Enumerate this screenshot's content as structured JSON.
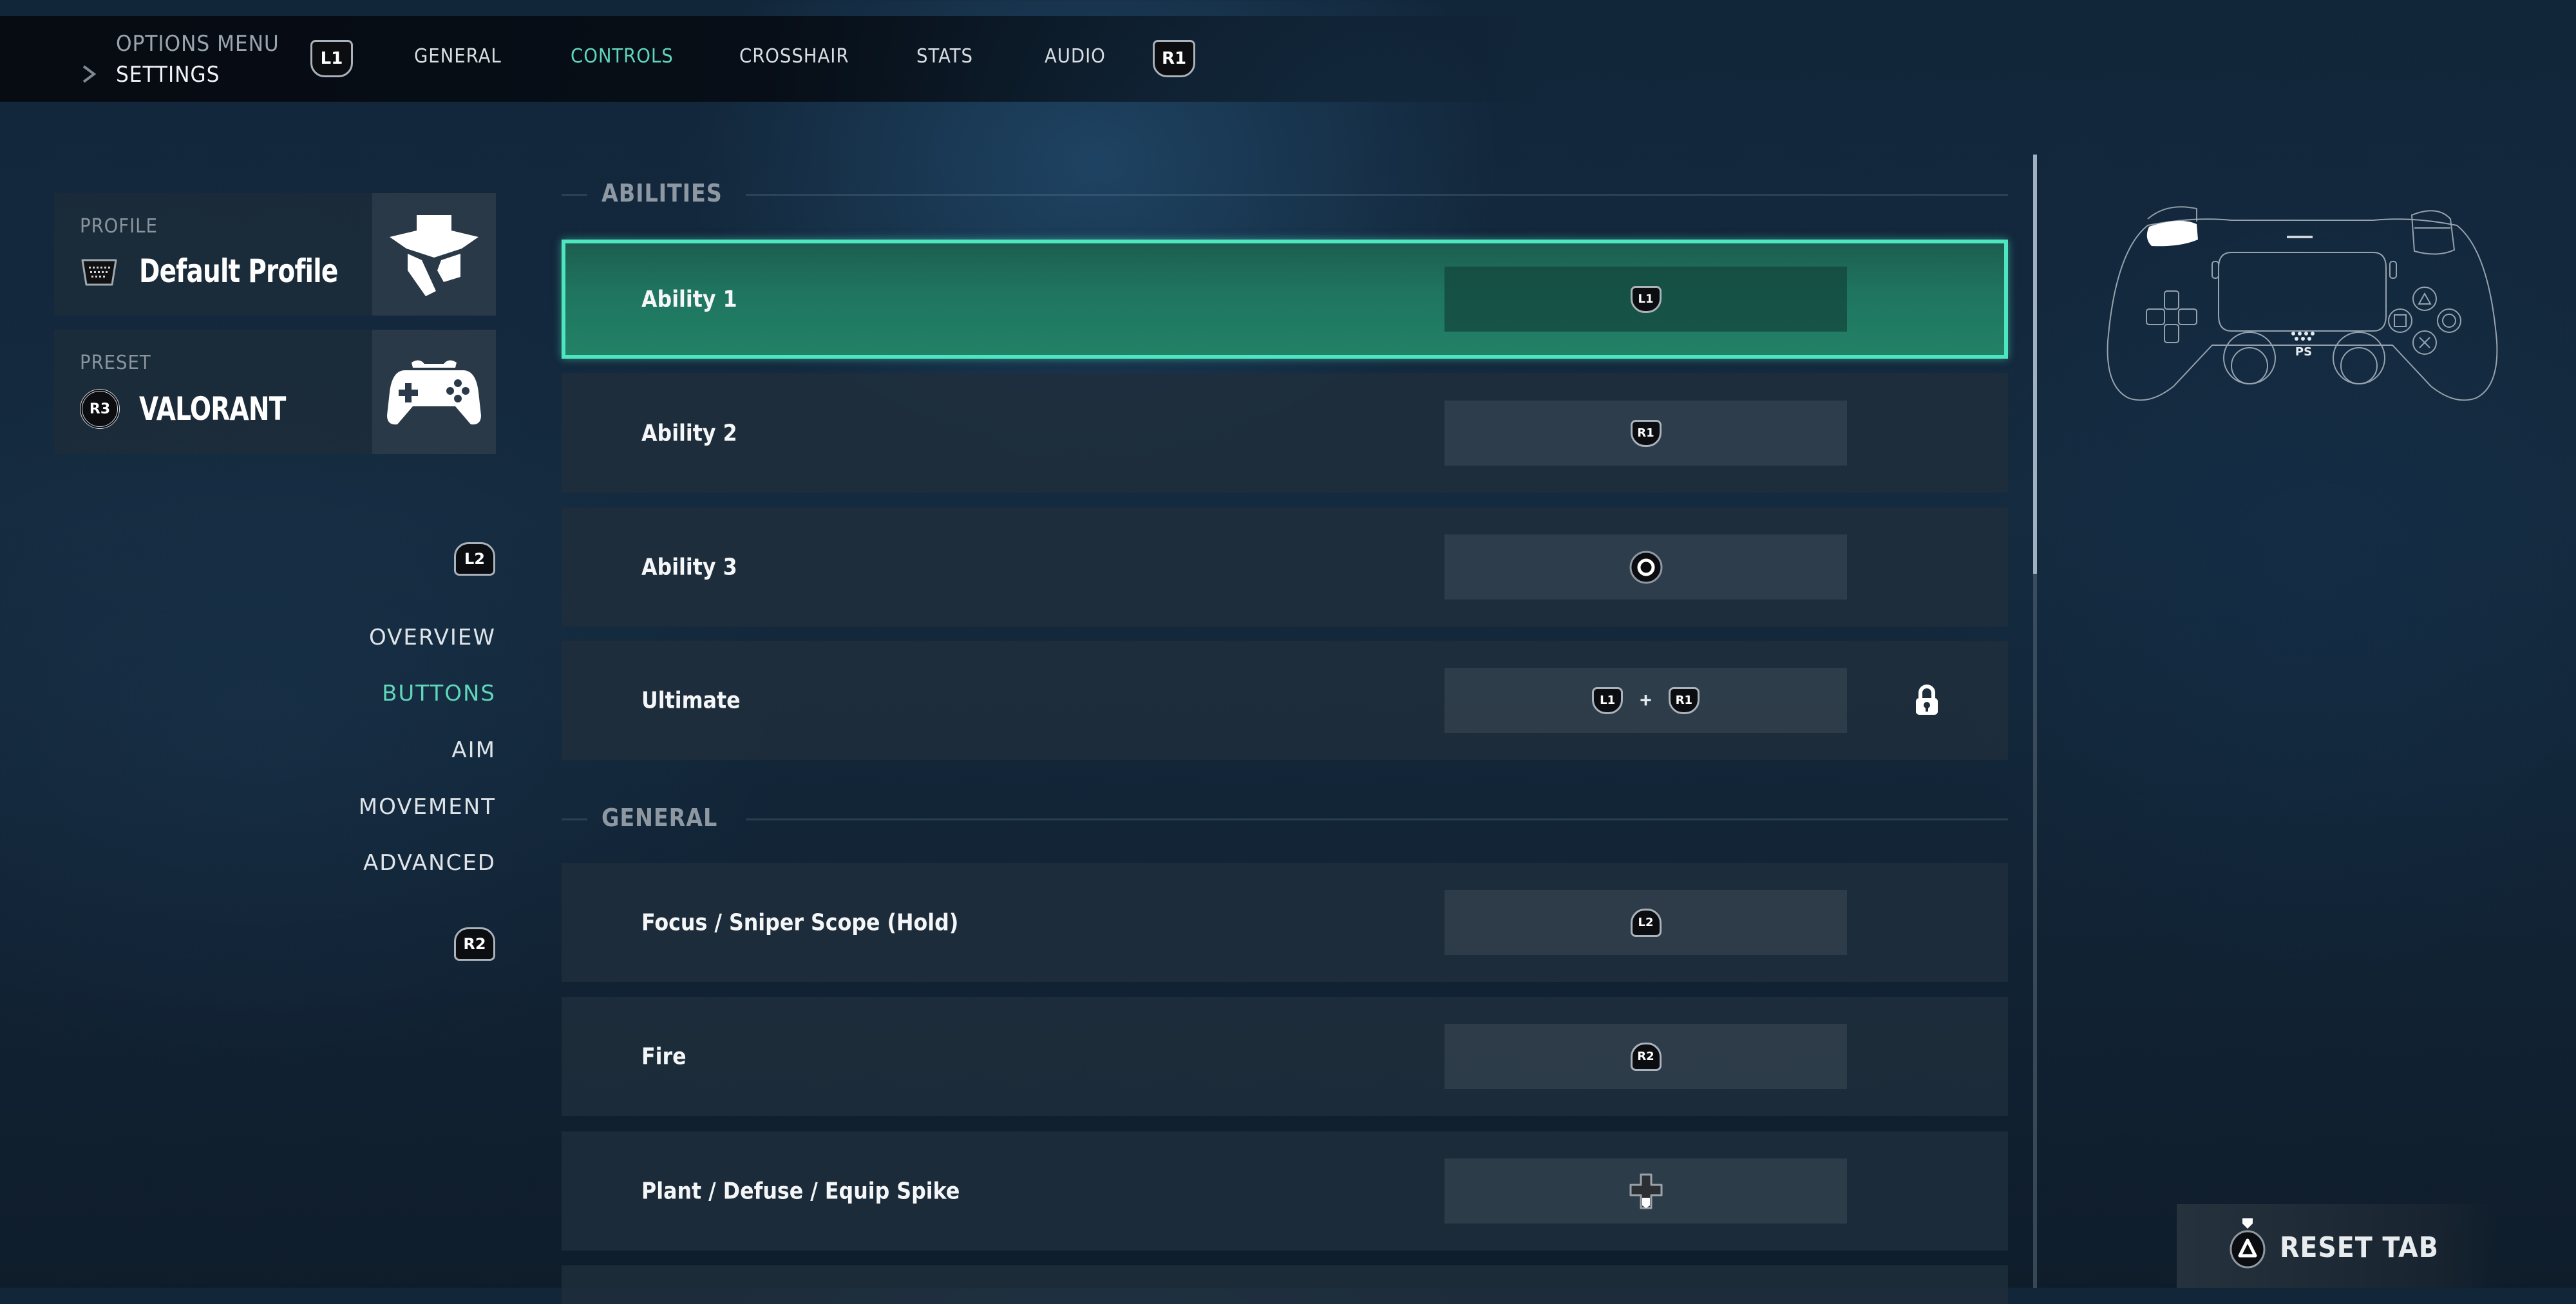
{
  "header": {
    "breadcrumb_parent": "OPTIONS MENU",
    "breadcrumb_current": "SETTINGS",
    "prev_tab_button": "L1",
    "next_tab_button": "R1",
    "tabs": [
      {
        "label": "GENERAL",
        "active": false
      },
      {
        "label": "CONTROLS",
        "active": true
      },
      {
        "label": "CROSSHAIR",
        "active": false
      },
      {
        "label": "STATS",
        "active": false
      },
      {
        "label": "AUDIO",
        "active": false
      }
    ]
  },
  "sidebar": {
    "profile": {
      "label": "PROFILE",
      "value": "Default Profile",
      "icon": "keyboard-icon",
      "tile_icon": "agent-hat-icon"
    },
    "preset": {
      "label": "PRESET",
      "value": "VALORANT",
      "button": "R3",
      "tile_icon": "gamepad-icon"
    },
    "prev_section_button": "L2",
    "next_section_button": "R2",
    "items": [
      {
        "label": "OVERVIEW",
        "active": false
      },
      {
        "label": "BUTTONS",
        "active": true
      },
      {
        "label": "AIM",
        "active": false
      },
      {
        "label": "MOVEMENT",
        "active": false
      },
      {
        "label": "ADVANCED",
        "active": false
      }
    ]
  },
  "sections": [
    {
      "title": "ABILITIES",
      "rows": [
        {
          "label": "Ability 1",
          "binding": [
            "L1"
          ],
          "selected": true,
          "locked": false
        },
        {
          "label": "Ability 2",
          "binding": [
            "R1"
          ],
          "selected": false,
          "locked": false
        },
        {
          "label": "Ability 3",
          "binding": [
            "circle"
          ],
          "selected": false,
          "locked": false
        },
        {
          "label": "Ultimate",
          "binding": [
            "L1",
            "R1"
          ],
          "binding_joiner": "+",
          "selected": false,
          "locked": true
        }
      ]
    },
    {
      "title": "GENERAL",
      "rows": [
        {
          "label": "Focus / Sniper Scope (Hold)",
          "binding": [
            "L2"
          ],
          "selected": false,
          "locked": false
        },
        {
          "label": "Fire",
          "binding": [
            "R2"
          ],
          "selected": false,
          "locked": false
        },
        {
          "label": "Plant / Defuse / Equip Spike",
          "binding": [
            "dpad-down"
          ],
          "selected": false,
          "locked": false
        }
      ]
    }
  ],
  "scroll": {
    "visible_fraction": 0.37,
    "position": 0
  },
  "controller_preview": {
    "highlighted_button": "L1"
  },
  "footer": {
    "reset_button": "triangle",
    "reset_label": "RESET TAB"
  },
  "colors": {
    "accent": "#5fd6bb",
    "selection_border": "#4ee6bf",
    "selection_fill": "#1f7560"
  }
}
